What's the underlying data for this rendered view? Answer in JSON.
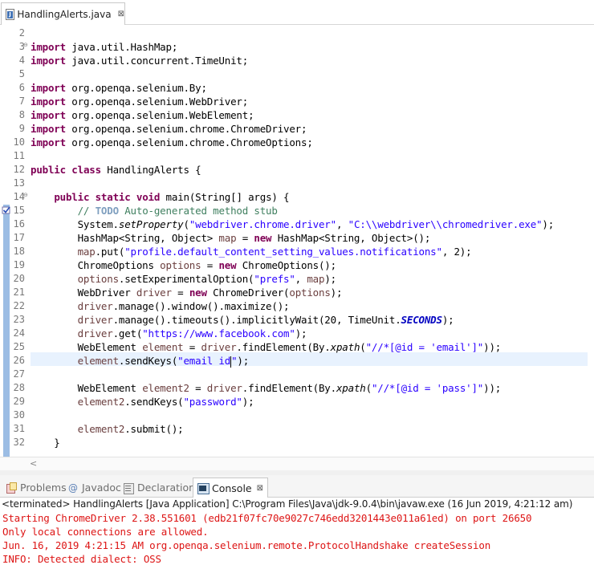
{
  "editor": {
    "tab_title": "HandlingAlerts.java",
    "tab_close": "⊠"
  },
  "code": {
    "line_numbers": [
      "2",
      "3",
      "4",
      "5",
      "6",
      "7",
      "8",
      "9",
      "10",
      "11",
      "12",
      "13",
      "14",
      "15",
      "16",
      "17",
      "18",
      "19",
      "20",
      "21",
      "22",
      "23",
      "24",
      "25",
      "26",
      "27",
      "28",
      "29",
      "30",
      "31",
      "32"
    ],
    "lines": [
      [],
      [
        [
          "kw",
          "import"
        ],
        [
          "p",
          " java.util.HashMap;"
        ]
      ],
      [
        [
          "kw",
          "import"
        ],
        [
          "p",
          " java.util.concurrent.TimeUnit;"
        ]
      ],
      [],
      [
        [
          "kw",
          "import"
        ],
        [
          "p",
          " org.openqa.selenium.By;"
        ]
      ],
      [
        [
          "kw",
          "import"
        ],
        [
          "p",
          " org.openqa.selenium.WebDriver;"
        ]
      ],
      [
        [
          "kw",
          "import"
        ],
        [
          "p",
          " org.openqa.selenium.WebElement;"
        ]
      ],
      [
        [
          "kw",
          "import"
        ],
        [
          "p",
          " org.openqa.selenium.chrome.ChromeDriver;"
        ]
      ],
      [
        [
          "kw",
          "import"
        ],
        [
          "p",
          " org.openqa.selenium.chrome.ChromeOptions;"
        ]
      ],
      [],
      [
        [
          "kw",
          "public"
        ],
        [
          "p",
          " "
        ],
        [
          "kw",
          "class"
        ],
        [
          "p",
          " HandlingAlerts {"
        ]
      ],
      [],
      [
        [
          "p",
          "    "
        ],
        [
          "kw",
          "public"
        ],
        [
          "p",
          " "
        ],
        [
          "kw",
          "static"
        ],
        [
          "p",
          " "
        ],
        [
          "kw",
          "void"
        ],
        [
          "p",
          " main(String[] args) {"
        ]
      ],
      [
        [
          "p",
          "        "
        ],
        [
          "cmt",
          "// "
        ],
        [
          "todo",
          "TODO"
        ],
        [
          "cmt",
          " Auto-generated method stub"
        ]
      ],
      [
        [
          "p",
          "        System."
        ],
        [
          "ital",
          "setProperty"
        ],
        [
          "p",
          "("
        ],
        [
          "str",
          "\"webdriver.chrome.driver\""
        ],
        [
          "p",
          ", "
        ],
        [
          "str",
          "\"C:\\\\webdriver\\\\chromedriver.exe\""
        ],
        [
          "p",
          ");"
        ]
      ],
      [
        [
          "p",
          "        HashMap<String, Object> "
        ],
        [
          "var",
          "map"
        ],
        [
          "p",
          " = "
        ],
        [
          "kw",
          "new"
        ],
        [
          "p",
          " HashMap<String, Object>();"
        ]
      ],
      [
        [
          "p",
          "        "
        ],
        [
          "var",
          "map"
        ],
        [
          "p",
          ".put("
        ],
        [
          "str",
          "\"profile.default_content_setting_values.notifications\""
        ],
        [
          "p",
          ", 2);"
        ]
      ],
      [
        [
          "p",
          "        ChromeOptions "
        ],
        [
          "var",
          "options"
        ],
        [
          "p",
          " = "
        ],
        [
          "kw",
          "new"
        ],
        [
          "p",
          " ChromeOptions();"
        ]
      ],
      [
        [
          "p",
          "        "
        ],
        [
          "var",
          "options"
        ],
        [
          "p",
          ".setExperimentalOption("
        ],
        [
          "str",
          "\"prefs\""
        ],
        [
          "p",
          ", "
        ],
        [
          "var",
          "map"
        ],
        [
          "p",
          ");"
        ]
      ],
      [
        [
          "p",
          "        WebDriver "
        ],
        [
          "var",
          "driver"
        ],
        [
          "p",
          " = "
        ],
        [
          "kw",
          "new"
        ],
        [
          "p",
          " ChromeDriver("
        ],
        [
          "var",
          "options"
        ],
        [
          "p",
          ");"
        ]
      ],
      [
        [
          "p",
          "        "
        ],
        [
          "var",
          "driver"
        ],
        [
          "p",
          ".manage().window().maximize();"
        ]
      ],
      [
        [
          "p",
          "        "
        ],
        [
          "var",
          "driver"
        ],
        [
          "p",
          ".manage().timeouts().implicitlyWait(20, TimeUnit."
        ],
        [
          "sfld",
          "SECONDS"
        ],
        [
          "p",
          ");"
        ]
      ],
      [
        [
          "p",
          "        "
        ],
        [
          "var",
          "driver"
        ],
        [
          "p",
          ".get("
        ],
        [
          "str",
          "\"https://www.facebook.com\""
        ],
        [
          "p",
          ");"
        ]
      ],
      [
        [
          "p",
          "        WebElement "
        ],
        [
          "var",
          "element"
        ],
        [
          "p",
          " = "
        ],
        [
          "var",
          "driver"
        ],
        [
          "p",
          ".findElement(By."
        ],
        [
          "ital",
          "xpath"
        ],
        [
          "p",
          "("
        ],
        [
          "str",
          "\"//*[@id = 'email']\""
        ],
        [
          "p",
          "));"
        ]
      ],
      [
        [
          "p",
          "        "
        ],
        [
          "var",
          "element"
        ],
        [
          "p",
          ".sendKeys("
        ],
        [
          "str",
          "\"email id"
        ],
        [
          "caret",
          ""
        ],
        [
          "str",
          "\""
        ],
        [
          "p",
          ");"
        ]
      ],
      [],
      [
        [
          "p",
          "        WebElement "
        ],
        [
          "var",
          "element2"
        ],
        [
          "p",
          " = "
        ],
        [
          "var",
          "driver"
        ],
        [
          "p",
          ".findElement(By."
        ],
        [
          "ital",
          "xpath"
        ],
        [
          "p",
          "("
        ],
        [
          "str",
          "\"//*[@id = 'pass']\""
        ],
        [
          "p",
          "));"
        ]
      ],
      [
        [
          "p",
          "        "
        ],
        [
          "var",
          "element2"
        ],
        [
          "p",
          ".sendKeys("
        ],
        [
          "str",
          "\"password\""
        ],
        [
          "p",
          ");"
        ]
      ],
      [],
      [
        [
          "p",
          "        "
        ],
        [
          "var",
          "element2"
        ],
        [
          "p",
          ".submit();"
        ]
      ],
      [
        [
          "p",
          "    }"
        ]
      ]
    ]
  },
  "panel": {
    "tabs": [
      {
        "label": "Problems",
        "icon": "problems-icon"
      },
      {
        "label": "Javadoc",
        "icon": "javadoc-icon"
      },
      {
        "label": "Declaration",
        "icon": "declaration-icon"
      },
      {
        "label": "Console",
        "icon": "console-icon",
        "close": "⊠"
      }
    ],
    "console": {
      "header": "<terminated> HandlingAlerts [Java Application] C:\\Program Files\\Java\\jdk-9.0.4\\bin\\javaw.exe (16 Jun 2019, 4:21:12 am)",
      "lines": [
        "Starting ChromeDriver 2.38.551601 (edb21f07fc70e9027c746edd3201443e011a61ed) on port 26650",
        "Only local connections are allowed.",
        "Jun. 16, 2019 4:21:15 AM org.openqa.selenium.remote.ProtocolHandshake createSession",
        "INFO: Detected dialect: OSS"
      ]
    }
  },
  "colors": {
    "keyword": "#7f0055",
    "string": "#2a00ff",
    "comment": "#3f7f5f",
    "console_error": "#dd1515",
    "current_line": "#e8f2fe"
  }
}
